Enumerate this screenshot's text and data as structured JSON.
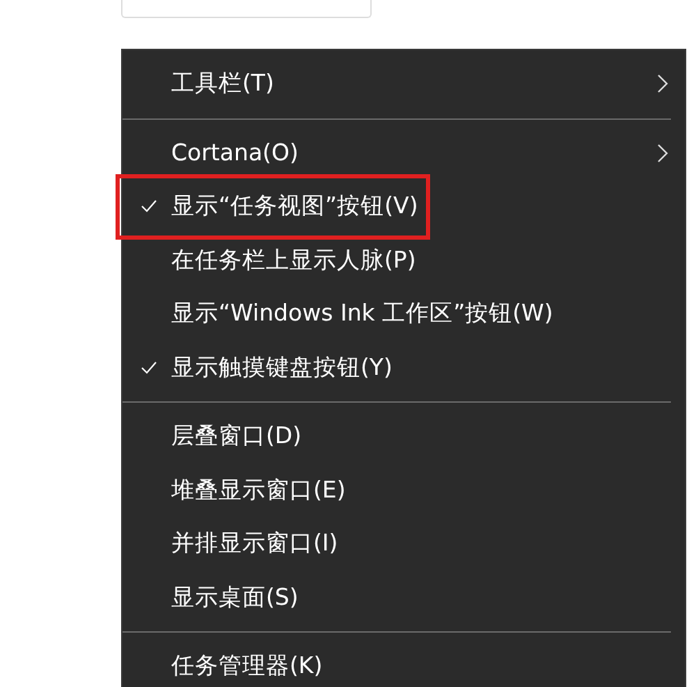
{
  "menu": {
    "items": [
      {
        "kind": "item",
        "label": "工具栏(T)",
        "checked": false,
        "submenu": true,
        "highlighted": false
      },
      {
        "kind": "separator"
      },
      {
        "kind": "item",
        "label": "Cortana(O)",
        "checked": false,
        "submenu": true,
        "highlighted": false
      },
      {
        "kind": "item",
        "label": "显示“任务视图”按钮(V)",
        "checked": true,
        "submenu": false,
        "highlighted": true
      },
      {
        "kind": "item",
        "label": "在任务栏上显示人脉(P)",
        "checked": false,
        "submenu": false,
        "highlighted": false
      },
      {
        "kind": "item",
        "label": "显示“Windows Ink 工作区”按钮(W)",
        "checked": false,
        "submenu": false,
        "highlighted": false
      },
      {
        "kind": "item",
        "label": "显示触摸键盘按钮(Y)",
        "checked": true,
        "submenu": false,
        "highlighted": false
      },
      {
        "kind": "separator"
      },
      {
        "kind": "item",
        "label": "层叠窗口(D)",
        "checked": false,
        "submenu": false,
        "highlighted": false
      },
      {
        "kind": "item",
        "label": "堆叠显示窗口(E)",
        "checked": false,
        "submenu": false,
        "highlighted": false
      },
      {
        "kind": "item",
        "label": "并排显示窗口(I)",
        "checked": false,
        "submenu": false,
        "highlighted": false
      },
      {
        "kind": "item",
        "label": "显示桌面(S)",
        "checked": false,
        "submenu": false,
        "highlighted": false
      },
      {
        "kind": "separator"
      },
      {
        "kind": "item",
        "label": "任务管理器(K)",
        "checked": false,
        "submenu": false,
        "highlighted": false
      }
    ]
  }
}
